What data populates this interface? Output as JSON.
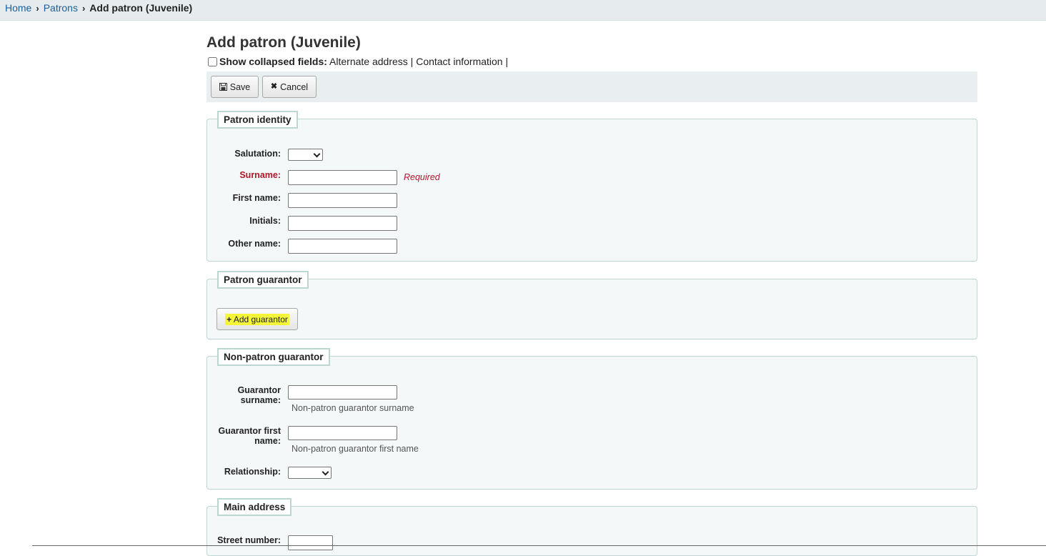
{
  "breadcrumb": {
    "home": "Home",
    "patrons": "Patrons",
    "current": "Add patron (Juvenile)",
    "separator": "›"
  },
  "page_title": "Add patron (Juvenile)",
  "collapsed": {
    "label": "Show collapsed fields:",
    "links": [
      "Alternate address",
      "Contact information"
    ],
    "divider": "|"
  },
  "toolbar": {
    "save_icon": "save-icon",
    "save_label": "Save",
    "cancel_icon": "times-icon",
    "cancel_label": "Cancel"
  },
  "identity": {
    "legend": "Patron identity",
    "salutation_label": "Salutation:",
    "surname_label": "Surname:",
    "surname_required": "Required",
    "firstname_label": "First name:",
    "initials_label": "Initials:",
    "othername_label": "Other name:"
  },
  "guarantor": {
    "legend": "Patron guarantor",
    "add_label": "Add guarantor",
    "add_icon": "plus-icon"
  },
  "nonpatron": {
    "legend": "Non-patron guarantor",
    "surname_label_1": "Guarantor",
    "surname_label_2": "surname:",
    "surname_hint": "Non-patron guarantor surname",
    "firstname_label_1": "Guarantor first",
    "firstname_label_2": "name:",
    "firstname_hint": "Non-patron guarantor first name",
    "relationship_label": "Relationship:"
  },
  "address": {
    "legend": "Main address",
    "street_number_label": "Street number:"
  },
  "colors": {
    "link": "#1a5e9a",
    "required": "#b2162a",
    "fieldset_bg": "#f4f8f9",
    "fieldset_border": "#bcd6d2",
    "highlight": "#f5f53a"
  }
}
